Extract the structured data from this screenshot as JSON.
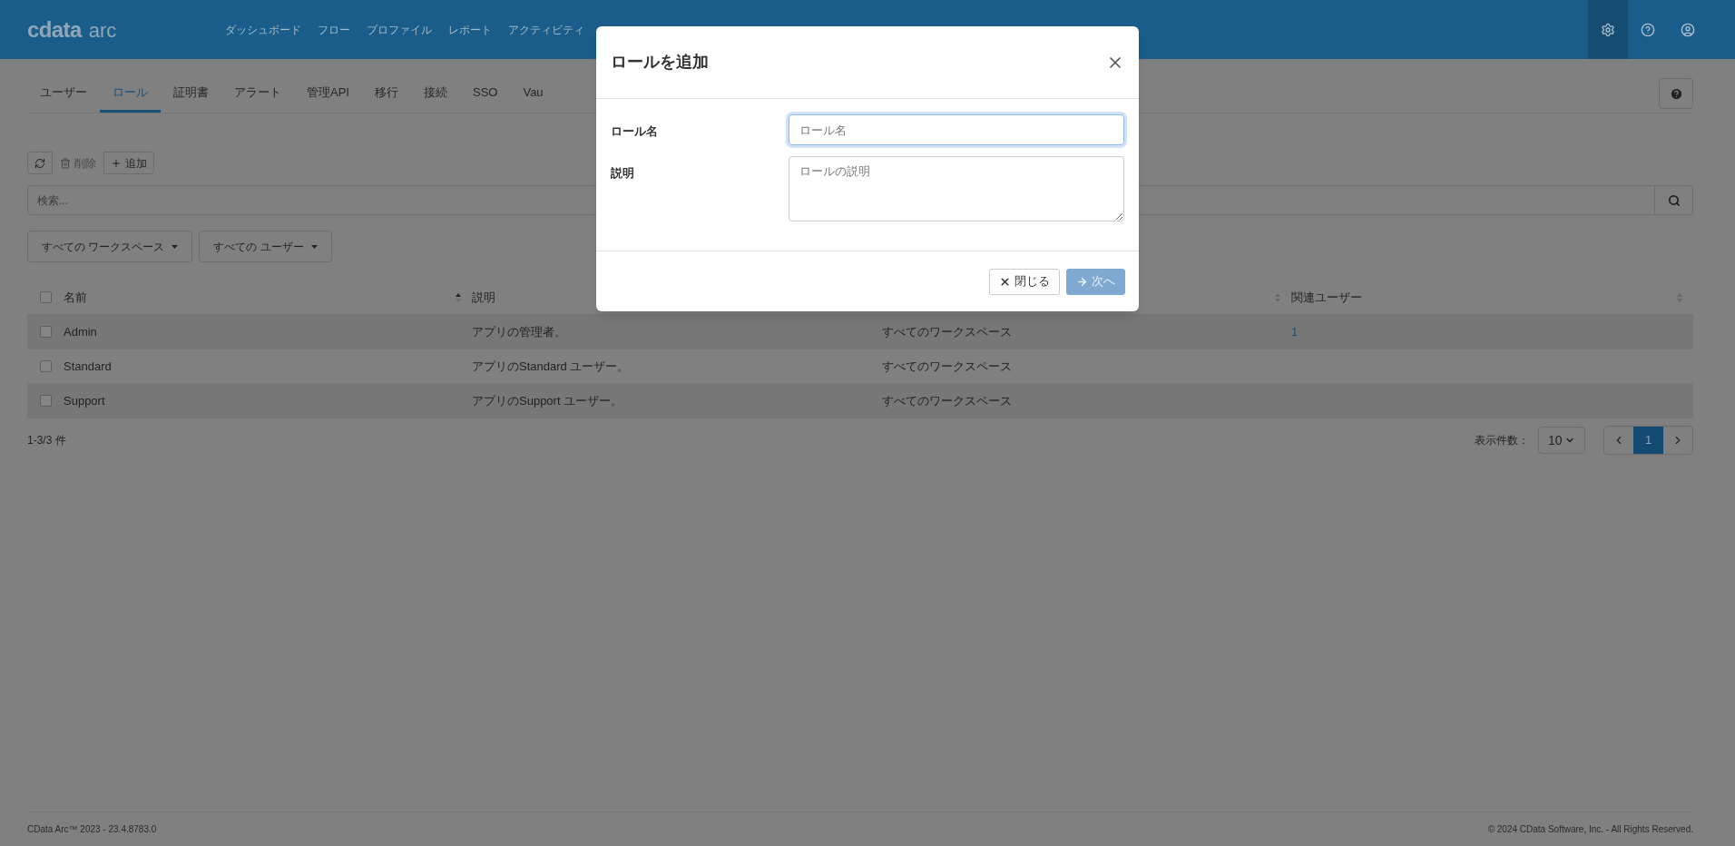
{
  "header": {
    "logo": {
      "brand": "cdata",
      "product": "arc"
    },
    "nav": [
      {
        "label": "ダッシュボード"
      },
      {
        "label": "フロー"
      },
      {
        "label": "プロファイル"
      },
      {
        "label": "レポート"
      },
      {
        "label": "アクティビティ"
      }
    ],
    "icons": [
      {
        "kind": "settings",
        "selected": true
      },
      {
        "kind": "help",
        "selected": false
      },
      {
        "kind": "user",
        "selected": false
      }
    ]
  },
  "tabs": [
    {
      "label": "ユーザー",
      "selected": false
    },
    {
      "label": "ロール",
      "selected": true
    },
    {
      "label": "証明書",
      "selected": false
    },
    {
      "label": "アラート",
      "selected": false
    },
    {
      "label": "管理API",
      "selected": false
    },
    {
      "label": "移行",
      "selected": false
    },
    {
      "label": "接続",
      "selected": false
    },
    {
      "label": "SSO",
      "selected": false
    },
    {
      "label": "Vau",
      "selected": false
    }
  ],
  "toolbar": [
    {
      "kind": "refresh",
      "disabled": false
    },
    {
      "kind": "delete",
      "label": "削除",
      "disabled": true
    },
    {
      "kind": "add",
      "label": "追加",
      "disabled": false
    }
  ],
  "search": {
    "placeholder": "検索..."
  },
  "filters": [
    {
      "label": "すべての ワークスペース"
    },
    {
      "label": "すべての ユーザー"
    }
  ],
  "table": {
    "all_checked": false,
    "columns": [
      {
        "label": "名前",
        "sortable": true,
        "sorted": true
      },
      {
        "label": "説明"
      },
      {
        "sortable": true,
        "sorted": false
      },
      {
        "label": "関連ユーザー",
        "sortable": true,
        "sorted": false
      }
    ],
    "rows": [
      {
        "checked": false,
        "name": "Admin",
        "description": "アプリの管理者。",
        "column_3": "すべてのワークスペース",
        "users": "1"
      },
      {
        "checked": false,
        "name": "Standard",
        "description": "アプリのStandard ユーザー。",
        "column_3": "すべてのワークスペース"
      },
      {
        "checked": false,
        "name": "Support",
        "description": "アプリのSupport ユーザー。",
        "column_3": "すべてのワークスペース"
      }
    ]
  },
  "pagination": {
    "summary": "1-3/3 件",
    "page_size_label": "表示件数：",
    "page_size": "10",
    "pages": [
      {
        "label": "1",
        "selected": true
      }
    ]
  },
  "footer": {
    "version": "CData Arc™ 2023 - 23.4.8783.0",
    "copyright": "© 2024 CData Software, Inc. - All Rights Reserved."
  },
  "modal": {
    "title": "ロールを追加",
    "fields": [
      {
        "kind": "input",
        "label": "ロール名",
        "placeholder": "ロール名",
        "focused": true
      },
      {
        "kind": "textarea",
        "label": "説明",
        "placeholder": "ロールの説明",
        "focused": false
      }
    ],
    "buttons": [
      {
        "kind": "close",
        "label": "閉じる",
        "disabled": false
      },
      {
        "kind": "next",
        "label": "次へ",
        "disabled": true
      }
    ]
  }
}
